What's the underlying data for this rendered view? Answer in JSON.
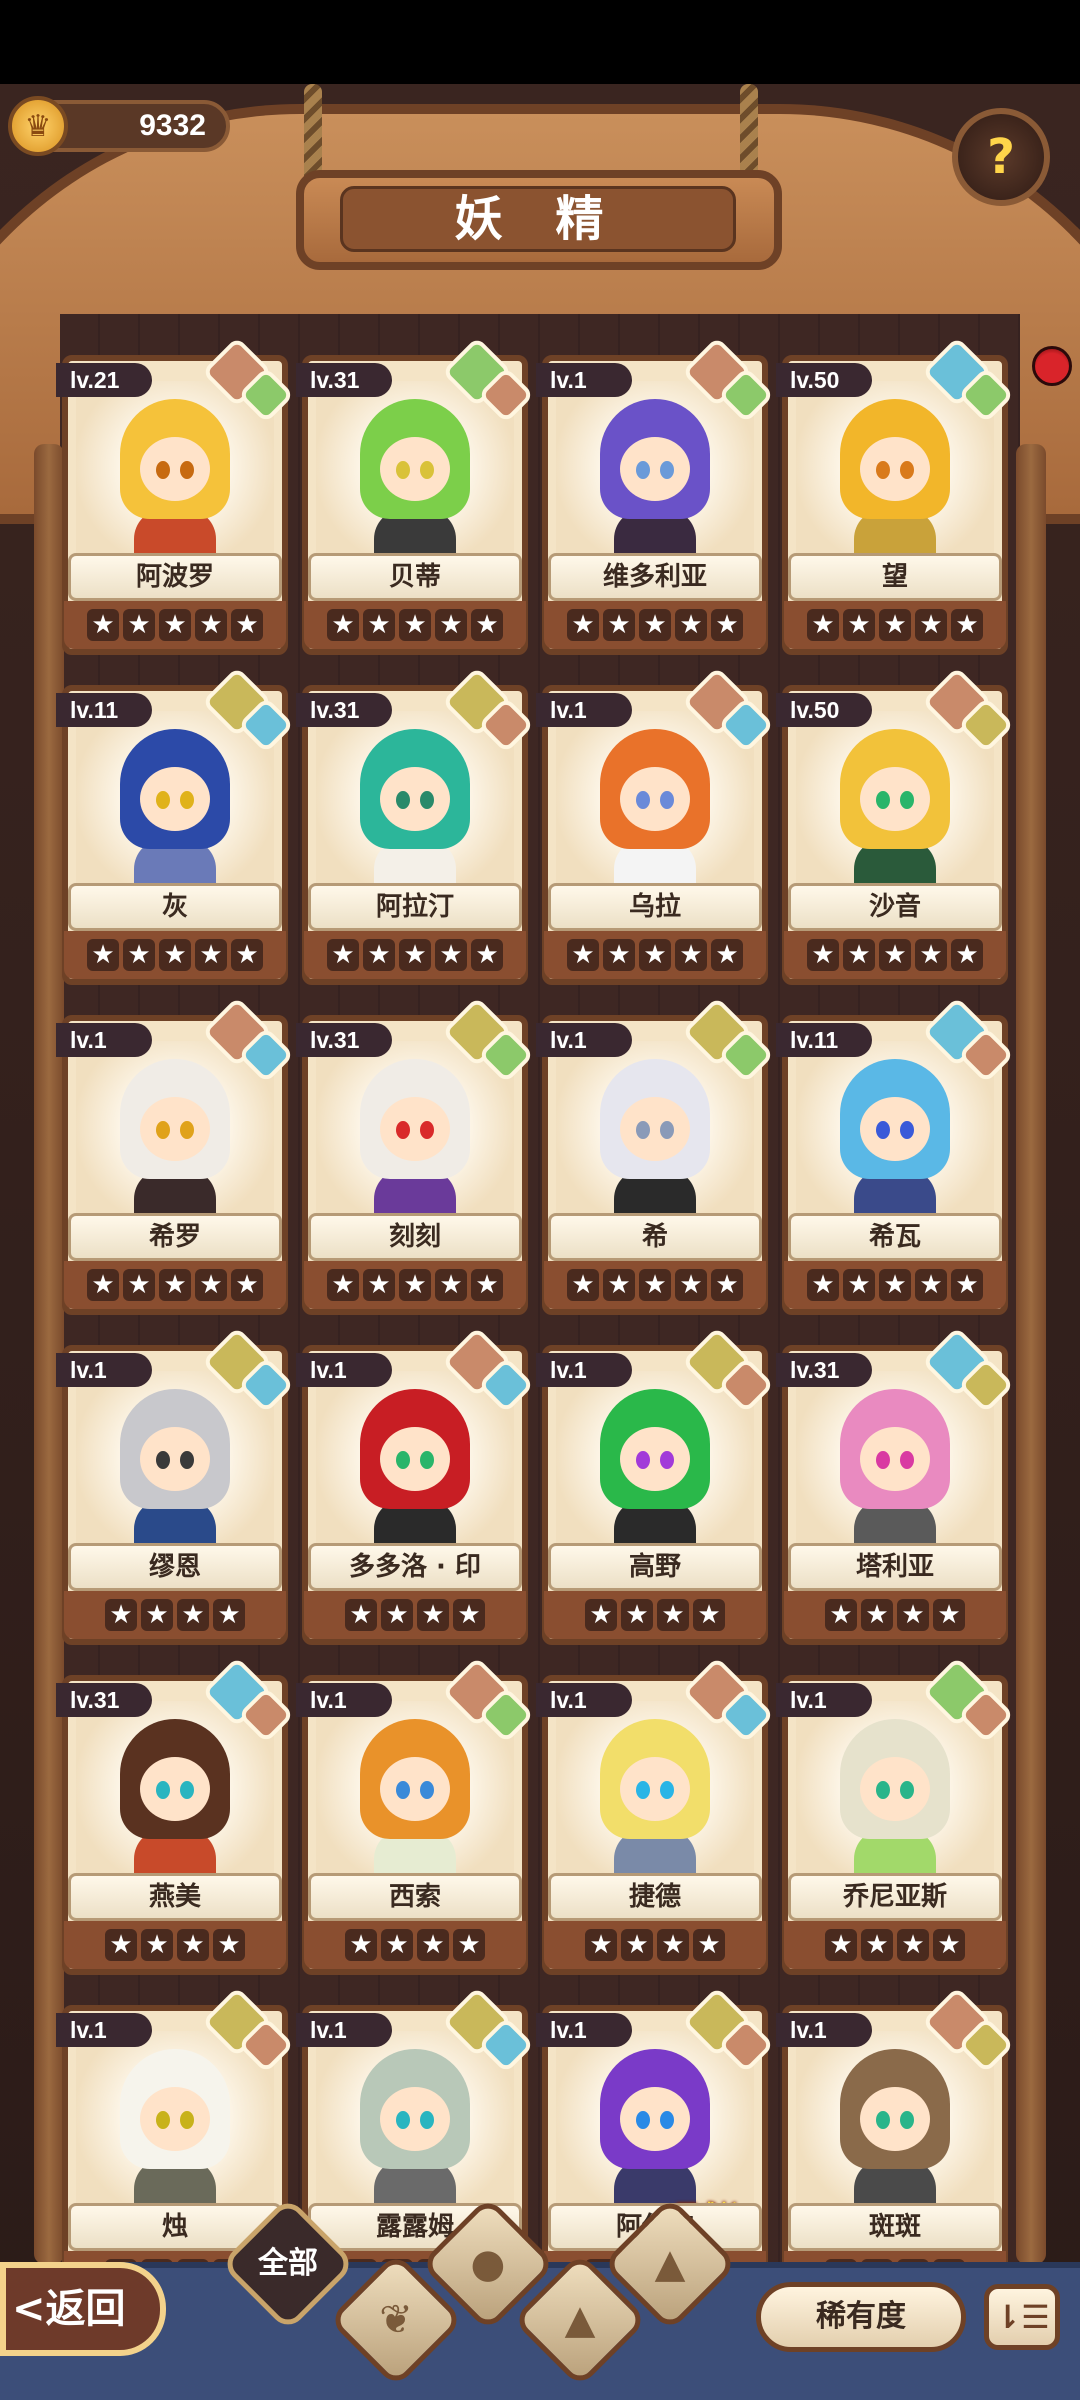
{
  "header": {
    "title": "妖 精",
    "coins": "9332",
    "help_glyph": "?"
  },
  "fairies": [
    {
      "level": "lv.21",
      "name": "阿波罗",
      "stars": 5,
      "hair": "#f5c23a",
      "outfit": "#c94a2a",
      "eye": "#c76a10",
      "gem": "#c98a6a",
      "gem2": "#8cc96a"
    },
    {
      "level": "lv.31",
      "name": "贝蒂",
      "stars": 5,
      "hair": "#7ccf4a",
      "outfit": "#3a3a3a",
      "eye": "#d9c23a",
      "gem": "#8cc96a",
      "gem2": "#c98a6a"
    },
    {
      "level": "lv.1",
      "name": "维多利亚",
      "stars": 5,
      "hair": "#6a52c8",
      "outfit": "#3a2a40",
      "eye": "#6a9ad9",
      "gem": "#c98a6a",
      "gem2": "#8cc96a"
    },
    {
      "level": "lv.50",
      "name": "望",
      "stars": 5,
      "hair": "#f2b62a",
      "outfit": "#c9a23a",
      "eye": "#d97a1a",
      "gem": "#6ac0d9",
      "gem2": "#8cc96a"
    },
    {
      "level": "lv.11",
      "name": "灰",
      "stars": 5,
      "hair": "#2c4aa8",
      "outfit": "#6a7ab8",
      "eye": "#e0b21a",
      "gem": "#c9b85a",
      "gem2": "#6ac0d9"
    },
    {
      "level": "lv.31",
      "name": "阿拉汀",
      "stars": 5,
      "hair": "#2cb69a",
      "outfit": "#f4f0e8",
      "eye": "#2a8a6a",
      "gem": "#c9b85a",
      "gem2": "#c98a6a"
    },
    {
      "level": "lv.1",
      "name": "乌拉",
      "stars": 5,
      "hair": "#e9722a",
      "outfit": "#f4f4f4",
      "eye": "#6a8ad9",
      "gem": "#c98a6a",
      "gem2": "#6ac0d9"
    },
    {
      "level": "lv.50",
      "name": "沙音",
      "stars": 5,
      "hair": "#f2c23a",
      "outfit": "#2a5a3a",
      "eye": "#2ab56a",
      "gem": "#c98a6a",
      "gem2": "#c9b85a"
    },
    {
      "level": "lv.1",
      "name": "希罗",
      "stars": 5,
      "hair": "#f0ece6",
      "outfit": "#3a2a2a",
      "eye": "#e0a21a",
      "gem": "#c98a6a",
      "gem2": "#6ac0d9"
    },
    {
      "level": "lv.31",
      "name": "刻刻",
      "stars": 5,
      "hair": "#f0ece6",
      "outfit": "#6a3a9a",
      "eye": "#d92a2a",
      "gem": "#c9b85a",
      "gem2": "#8cc96a"
    },
    {
      "level": "lv.1",
      "name": "希",
      "stars": 5,
      "hair": "#e6e6ee",
      "outfit": "#2a2a2a",
      "eye": "#8a9ab8",
      "gem": "#c9b85a",
      "gem2": "#8cc96a"
    },
    {
      "level": "lv.11",
      "name": "希瓦",
      "stars": 5,
      "hair": "#5ab8e6",
      "outfit": "#3a4a8a",
      "eye": "#3a5ad9",
      "gem": "#6ac0d9",
      "gem2": "#c98a6a"
    },
    {
      "level": "lv.1",
      "name": "缪恩",
      "stars": 4,
      "hair": "#c8c8cc",
      "outfit": "#2a4a8a",
      "eye": "#3a3a3a",
      "gem": "#c9b85a",
      "gem2": "#6ac0d9"
    },
    {
      "level": "lv.1",
      "name": "多多洛 · 印",
      "stars": 4,
      "hair": "#c81e24",
      "outfit": "#2a2a2a",
      "eye": "#2ab56a",
      "gem": "#c98a6a",
      "gem2": "#6ac0d9"
    },
    {
      "level": "lv.1",
      "name": "高野",
      "stars": 4,
      "hair": "#2ab84a",
      "outfit": "#2a2a2a",
      "eye": "#a23ad9",
      "gem": "#c9b85a",
      "gem2": "#c98a6a"
    },
    {
      "level": "lv.31",
      "name": "塔利亚",
      "stars": 4,
      "hair": "#e98ac0",
      "outfit": "#5a5a5a",
      "eye": "#d93aa2",
      "gem": "#6ac0d9",
      "gem2": "#c9b85a"
    },
    {
      "level": "lv.31",
      "name": "燕美",
      "stars": 4,
      "hair": "#5a3220",
      "outfit": "#c84a2a",
      "eye": "#2ab5c0",
      "gem": "#6ac0d9",
      "gem2": "#c98a6a"
    },
    {
      "level": "lv.1",
      "name": "西索",
      "stars": 4,
      "hair": "#e9922a",
      "outfit": "#e6ecd2",
      "eye": "#3a8ad9",
      "gem": "#c98a6a",
      "gem2": "#8cc96a"
    },
    {
      "level": "lv.1",
      "name": "捷德",
      "stars": 4,
      "hair": "#f2de6a",
      "outfit": "#7a8aa8",
      "eye": "#2ab5e6",
      "gem": "#c98a6a",
      "gem2": "#6ac0d9"
    },
    {
      "level": "lv.1",
      "name": "乔尼亚斯",
      "stars": 4,
      "hair": "#e6e2cc",
      "outfit": "#a2d96a",
      "eye": "#2ab58a",
      "gem": "#8cc96a",
      "gem2": "#c98a6a"
    },
    {
      "level": "lv.1",
      "name": "烛",
      "stars": 4,
      "hair": "#f6f4ec",
      "outfit": "#6a6a5a",
      "eye": "#c8b21a",
      "gem": "#c9b85a",
      "gem2": "#c98a6a"
    },
    {
      "level": "lv.1",
      "name": "露露姆",
      "stars": 4,
      "hair": "#b8c8b8",
      "outfit": "#6a6a6a",
      "eye": "#2ab5c0",
      "gem": "#c9b85a",
      "gem2": "#6ac0d9"
    },
    {
      "level": "lv.1",
      "name": "阿保吉",
      "stars": 4,
      "hair": "#7a3ac8",
      "outfit": "#3a3a6a",
      "eye": "#2a8ae6",
      "gem": "#c9b85a",
      "gem2": "#c98a6a",
      "tag": "可成长"
    },
    {
      "level": "lv.1",
      "name": "斑斑",
      "stars": 4,
      "hair": "#8a6a4a",
      "outfit": "#4a4a4a",
      "eye": "#2ab58a",
      "gem": "#c98a6a",
      "gem2": "#c9b85a"
    }
  ],
  "bottom_bar": {
    "back_label": "<返回",
    "filter_all_label": "全部",
    "rarity_label": "稀有度",
    "sort_glyph": "⇂☰"
  }
}
